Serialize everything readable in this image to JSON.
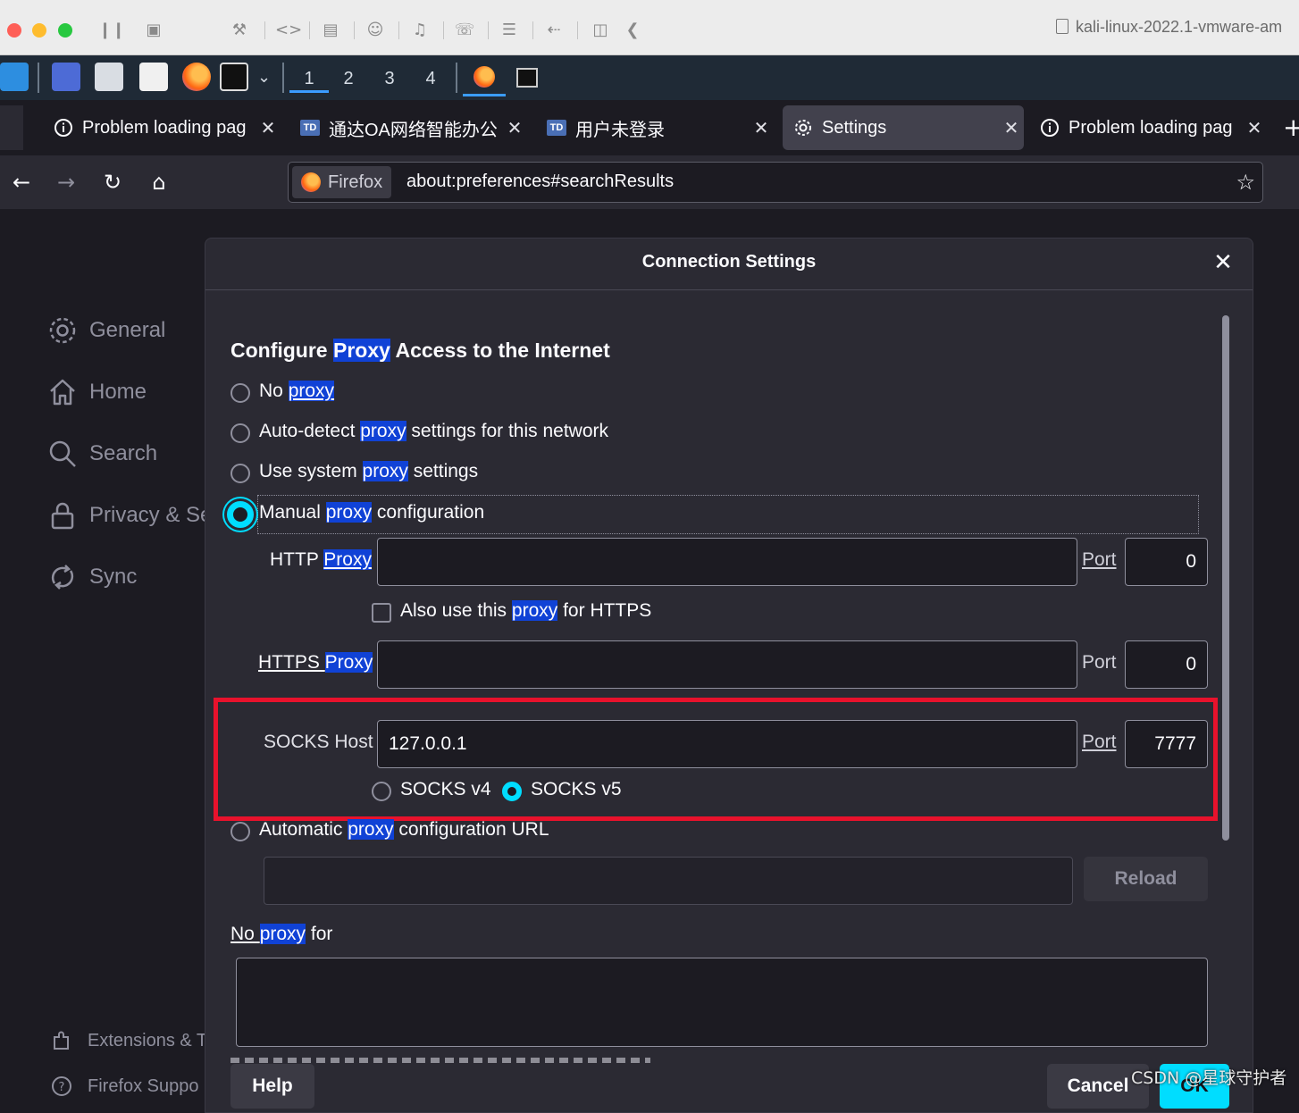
{
  "vm_window": {
    "title": "kali-linux-2022.1-vmware-am"
  },
  "kali_panel": {
    "workspaces": [
      "1",
      "2",
      "3",
      "4"
    ]
  },
  "tabs": [
    {
      "label": "Problem loading pag",
      "icon": "info-icon"
    },
    {
      "label": "通达OA网络智能办公",
      "icon": "td-badge"
    },
    {
      "label": "用户未登录",
      "icon": "td-badge"
    },
    {
      "label": "Settings",
      "icon": "gear-icon"
    },
    {
      "label": "Problem loading pag",
      "icon": "info-icon"
    }
  ],
  "tab_badge": "TD",
  "navbar": {
    "identity_label": "Firefox",
    "url": "about:preferences#searchResults"
  },
  "sidebar": {
    "items": [
      {
        "label": "General",
        "icon": "gear-icon"
      },
      {
        "label": "Home",
        "icon": "home-icon"
      },
      {
        "label": "Search",
        "icon": "search-icon"
      },
      {
        "label": "Privacy & Se",
        "icon": "lock-icon"
      },
      {
        "label": "Sync",
        "icon": "sync-icon"
      }
    ],
    "footer": [
      {
        "label": "Extensions & T",
        "icon": "puzzle-icon"
      },
      {
        "label": "Firefox Suppo",
        "icon": "help-icon"
      }
    ]
  },
  "dialog": {
    "title": "Connection Settings",
    "heading_pre": "Configure ",
    "heading_hl": "Proxy",
    "heading_post": " Access to the Internet",
    "proxy_word": "proxy",
    "proxy_word_cap": "Proxy",
    "options": {
      "no_proxy_pre": "No ",
      "auto_detect_pre": "Auto-detect ",
      "auto_detect_post": " settings for this network",
      "system_pre": "Use system ",
      "system_post": " settings",
      "manual_pre": "Manual ",
      "manual_post": " configuration",
      "auto_url_pre": "Automatic ",
      "auto_url_post": " configuration URL"
    },
    "selected_mode": "manual",
    "http": {
      "label_pre": "HTTP ",
      "value": "",
      "port_label": "Port",
      "port": "0"
    },
    "also_https_pre": "Also use this ",
    "also_https_post": " for HTTPS",
    "https": {
      "label_pre": "HTTPS ",
      "value": "",
      "port_label": "Port",
      "port": "0"
    },
    "socks": {
      "label": "SOCKS Host",
      "value": "127.0.0.1",
      "port_label": "Port",
      "port": "7777",
      "v4": "SOCKS v4",
      "v5": "SOCKS v5",
      "selected": "v5"
    },
    "reload_label": "Reload",
    "no_proxy_for_pre": "No ",
    "no_proxy_for_post": " for",
    "no_proxy_value": "",
    "help_label": "Help",
    "cancel_label": "Cancel",
    "ok_label": "OK"
  },
  "watermark": "CSDN @星球守护者",
  "colors": {
    "accent": "#00ddff",
    "highlight": "#1042d6",
    "annotation": "#e8122c"
  }
}
